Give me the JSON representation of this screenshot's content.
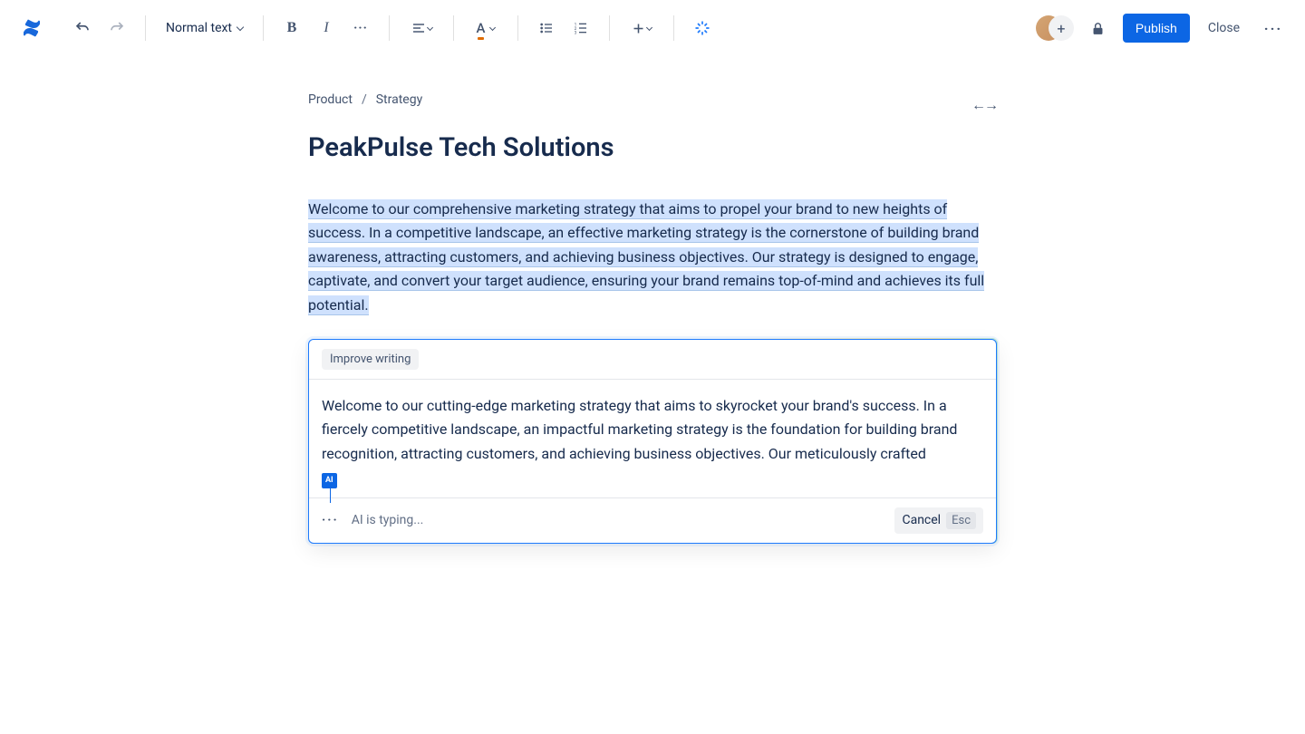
{
  "toolbar": {
    "text_style": "Normal text"
  },
  "header_right": {
    "publish": "Publish",
    "close": "Close"
  },
  "breadcrumb": {
    "item1": "Product",
    "item2": "Strategy"
  },
  "page": {
    "title": "PeakPulse Tech Solutions",
    "body": "Welcome to our comprehensive marketing strategy that aims to propel your brand to new heights of success. In a competitive landscape, an effective marketing strategy is the cornerstone of building brand awareness, attracting customers, and achieving business objectives. Our strategy is designed to engage, captivate, and convert your target audience, ensuring your brand remains top-of-mind and achieves its full potential."
  },
  "ai": {
    "chip": "Improve writing",
    "suggestion": "Welcome to our cutting-edge marketing strategy that aims to skyrocket your brand's success. In a fiercely competitive landscape, an impactful marketing strategy is the foundation for building brand recognition, attracting customers, and achieving business objectives. Our meticulously crafted",
    "badge": "AI",
    "typing": "AI is typing...",
    "cancel": "Cancel",
    "esc": "Esc"
  }
}
